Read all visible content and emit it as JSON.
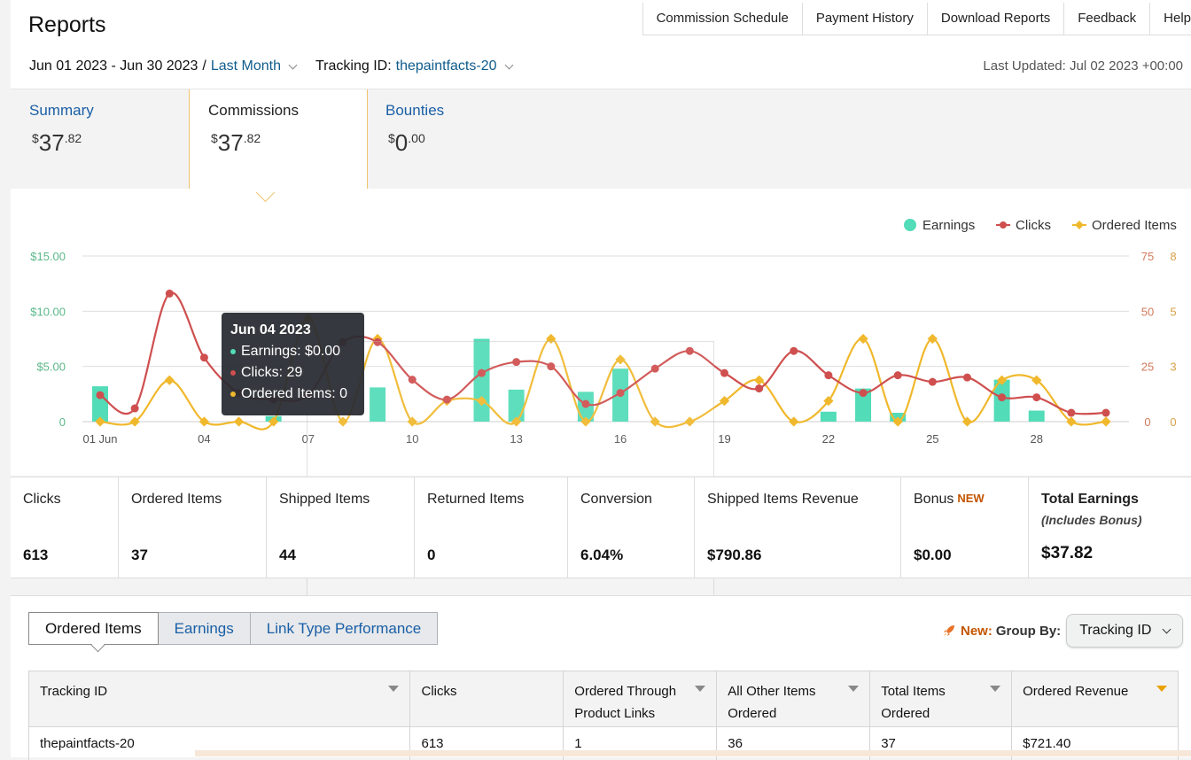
{
  "header": {
    "title": "Reports",
    "top_links": [
      "Commission Schedule",
      "Payment History",
      "Download Reports",
      "Feedback",
      "Help"
    ],
    "date_range": "Jun 01 2023 - Jun 30 2023",
    "separator": "/",
    "preset": "Last Month",
    "tracking_label": "Tracking ID:",
    "tracking_value": "thepaintfacts-20",
    "last_updated": "Last Updated: Jul 02 2023 +00:00"
  },
  "summary_tabs": [
    {
      "label": "Summary",
      "currency": "$",
      "whole": "37",
      "cents": ".82"
    },
    {
      "label": "Commissions",
      "currency": "$",
      "whole": "37",
      "cents": ".82"
    },
    {
      "label": "Bounties",
      "currency": "$",
      "whole": "0",
      "cents": ".00"
    }
  ],
  "colors": {
    "earnings": "#52dcb8",
    "clicks": "#cf4f4f",
    "ordered": "#f0b82c",
    "link": "#0f5c8c",
    "accent": "#c45500"
  },
  "chart_data": {
    "type": "line",
    "legend": [
      "Earnings",
      "Clicks",
      "Ordered Items"
    ],
    "legend_position": "top-right",
    "x_tick_labels": [
      "01 Jun",
      "04",
      "07",
      "10",
      "13",
      "16",
      "19",
      "22",
      "25",
      "28"
    ],
    "x": [
      1,
      2,
      3,
      4,
      5,
      6,
      7,
      8,
      9,
      10,
      11,
      12,
      13,
      14,
      15,
      16,
      17,
      18,
      19,
      20,
      21,
      22,
      23,
      24,
      25,
      26,
      27,
      28,
      29,
      30
    ],
    "y_left_ticks": [
      "0",
      "$5.00",
      "$10.00",
      "$15.00"
    ],
    "y_right1_ticks": [
      "0",
      "25",
      "50",
      "75"
    ],
    "y_right2_ticks": [
      "0",
      "3",
      "5",
      "8"
    ],
    "y_left_range": [
      0,
      15
    ],
    "y_right1_range": [
      0,
      75
    ],
    "y_right2_range": [
      0,
      8
    ],
    "grid": true,
    "series": [
      {
        "name": "Earnings",
        "type": "bar",
        "axis": "left",
        "values": [
          3.2,
          0,
          0,
          0,
          0,
          0.5,
          0,
          0,
          3.1,
          0,
          0,
          7.5,
          2.9,
          0,
          2.7,
          4.8,
          0,
          0,
          0,
          0,
          0,
          0.9,
          3.0,
          0.8,
          0,
          0,
          3.8,
          1.0,
          0,
          0
        ]
      },
      {
        "name": "Clicks",
        "type": "line",
        "axis": "right1",
        "values": [
          12,
          6,
          58,
          29,
          13,
          10,
          12,
          36,
          36,
          19,
          10,
          22,
          27,
          25,
          8,
          13,
          24,
          32,
          22,
          15,
          32,
          21,
          13,
          21,
          18,
          20,
          11,
          11,
          4,
          4
        ]
      },
      {
        "name": "Ordered Items",
        "type": "line",
        "axis": "right2",
        "values": [
          0,
          0,
          2,
          0,
          0,
          0,
          5,
          0,
          4,
          0,
          1,
          1,
          0,
          4,
          0,
          3,
          0,
          0,
          1,
          2,
          0,
          1,
          4,
          0,
          4,
          0,
          2,
          2,
          0,
          0
        ]
      }
    ],
    "tooltip": {
      "title": "Jun 04 2023",
      "earnings": "Earnings: $0.00",
      "clicks": "Clicks: 29",
      "ordered": "Ordered Items: 0"
    }
  },
  "metrics": [
    {
      "label": "Clicks",
      "value": "613"
    },
    {
      "label": "Ordered Items",
      "value": "37"
    },
    {
      "label": "Shipped Items",
      "value": "44"
    },
    {
      "label": "Returned Items",
      "value": "0"
    },
    {
      "label": "Conversion",
      "value": "6.04%"
    },
    {
      "label": "Shipped Items Revenue",
      "value": "$790.86"
    },
    {
      "label": "Bonus",
      "badge": "NEW",
      "value": "$0.00"
    },
    {
      "label": "Total Earnings",
      "sub": "(Includes Bonus)",
      "value": "$37.82"
    }
  ],
  "bottom": {
    "tabs": [
      "Ordered Items",
      "Earnings",
      "Link Type Performance"
    ],
    "new_label": "New:",
    "group_by_label": "Group By:",
    "group_by_value": "Tracking ID",
    "table_headers": [
      "Tracking ID",
      "Clicks",
      "Ordered Through Product Links",
      "All Other Items Ordered",
      "Total Items Ordered",
      "Ordered Revenue"
    ],
    "rows": [
      [
        "thepaintfacts-20",
        "613",
        "1",
        "36",
        "37",
        "$721.40"
      ]
    ]
  }
}
